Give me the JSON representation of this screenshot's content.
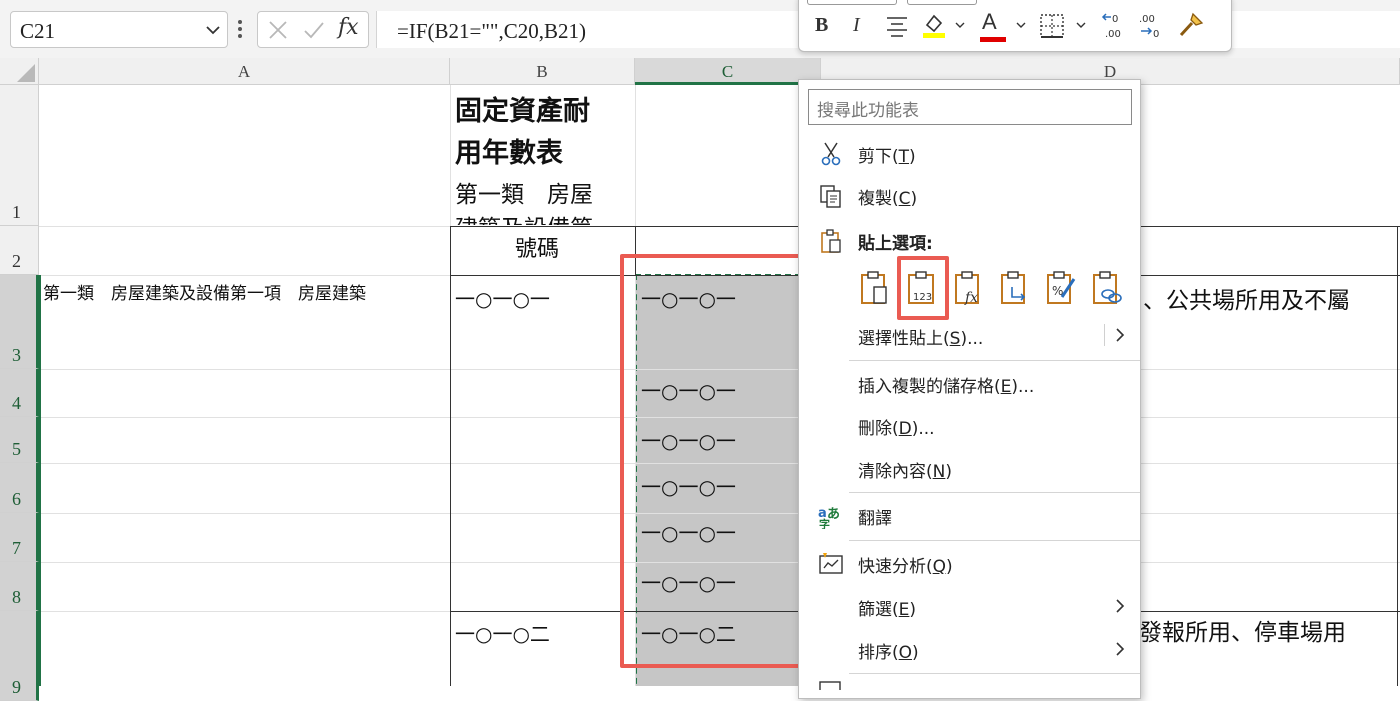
{
  "name_box": {
    "value": "C21"
  },
  "formula_bar": {
    "formula": "=IF(B21=\"\",C20,B21)",
    "fx_label": "fx"
  },
  "columns": [
    "A",
    "B",
    "C",
    "D"
  ],
  "rows": [
    "1",
    "2",
    "3",
    "4",
    "5",
    "6",
    "7",
    "8",
    "9"
  ],
  "cells": {
    "b1_line1": "固定資產耐",
    "b1_line2": "用年數表",
    "b1_line3": "第一類　房屋",
    "b1_line4": "建築及設備第",
    "b2": "號碼",
    "a3": "第一類　房屋建築及設備第一項　房屋建築",
    "b3": "一○一○一",
    "c3": "一○一○一",
    "c4": "一○一○一",
    "c5": "一○一○一",
    "c6": "一○一○一",
    "c7": "一○一○一",
    "c8": "一○一○一",
    "b9": "一○一○二",
    "c9": "一○一○二",
    "d3": "、公共場所用及不屬",
    "d9": "發報所用、停車場用"
  },
  "mini_toolbar": {
    "bold": "B",
    "italic": "I",
    "font_color_letter": "A",
    "fill_color": "#ffff00",
    "font_color": "#e00000"
  },
  "context_menu": {
    "search_placeholder": "搜尋此功能表",
    "cut": {
      "label": "剪下(",
      "key": "T",
      "end": ")"
    },
    "copy": {
      "label": "複製(",
      "key": "C",
      "end": ")"
    },
    "paste_options": "貼上選項:",
    "paste_special": {
      "label": "選擇性貼上(",
      "key": "S",
      "end": ")..."
    },
    "insert_copied": {
      "label": "插入複製的儲存格(",
      "key": "E",
      "end": ")..."
    },
    "delete": {
      "label": "刪除(",
      "key": "D",
      "end": ")..."
    },
    "clear": {
      "label": "清除內容(",
      "key": "N",
      "end": ")"
    },
    "translate": {
      "label": "翻譯"
    },
    "quick_analysis": {
      "label": "快速分析(",
      "key": "Q",
      "end": ")"
    },
    "filter": {
      "label": "篩選(",
      "key": "E",
      "end": ")"
    },
    "sort": {
      "label": "排序(",
      "key": "O",
      "end": ")"
    },
    "paste_values_icon_text": "123"
  },
  "colors": {
    "accent_green": "#217346",
    "highlight_red": "#ea5b52",
    "selection_gray": "#c6c6c6",
    "icon_orange": "#c07820"
  }
}
